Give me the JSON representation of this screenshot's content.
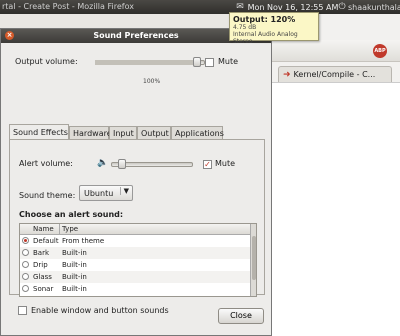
{
  "background": {
    "window_title": "rtal - Create Post - Mozilla Firefox",
    "tab_label": "Kernel/Compile - C..."
  },
  "panel": {
    "clock": "Mon Nov 16, 12:55 AM",
    "user": "shaakunthala"
  },
  "osd": {
    "title": "Output: 120%",
    "sub1": "4.75 dB",
    "sub2": "Internal Audio Analog Stereo"
  },
  "dialog": {
    "title": "Sound Preferences",
    "output_label": "Output volume:",
    "output_mute_label": "Mute",
    "output_percent": "100%",
    "output_level": 0.9,
    "tabs": [
      "Sound Effects",
      "Hardware",
      "Input",
      "Output",
      "Applications"
    ],
    "alert_label": "Alert volume:",
    "alert_mute_label": "Mute",
    "alert_muted": true,
    "theme_label": "Sound theme:",
    "theme_value": "Ubuntu",
    "choose_heading": "Choose an alert sound:",
    "table_headers": {
      "name": "Name",
      "type": "Type"
    },
    "sounds": [
      {
        "name": "Default",
        "type": "From theme",
        "selected": true
      },
      {
        "name": "Bark",
        "type": "Built-in",
        "selected": false
      },
      {
        "name": "Drip",
        "type": "Built-in",
        "selected": false
      },
      {
        "name": "Glass",
        "type": "Built-in",
        "selected": false
      },
      {
        "name": "Sonar",
        "type": "Built-in",
        "selected": false
      }
    ],
    "window_sounds_label": "Enable window and button sounds",
    "close_label": "Close"
  },
  "colors": {
    "accent": "#c0392b",
    "titlebar": "#3c3b38",
    "osd_bg": "#fbf7c6"
  },
  "icons": [
    "close-icon",
    "volume-icon",
    "mail-icon",
    "power-icon",
    "chevron-down-icon"
  ]
}
